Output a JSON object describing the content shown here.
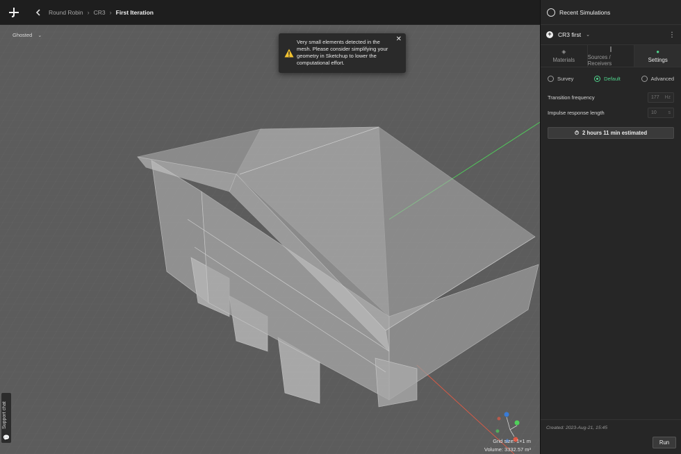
{
  "app": {
    "logo": "plus-logo-icon"
  },
  "breadcrumb": {
    "project": "Round Robin",
    "model": "CR3",
    "current": "First Iteration"
  },
  "viewport": {
    "view_mode": "Ghosted",
    "toast": {
      "message": "Very small elements detected in the mesh. Please consider simplifying your geometry in Sketchup to lower the computational effort.",
      "icon": "warning-icon"
    },
    "grid_size": "Grid size: 1×1 m",
    "volume": "Volume: 3332.57 m³",
    "axes": {
      "x_color": "#e05a45",
      "y_color": "#4fd15a",
      "z_color": "#3a7bd5"
    },
    "support_chat": "Support chat"
  },
  "panel": {
    "title": "Recent Simulations",
    "simulation_name": "CR3 first",
    "tabs": [
      {
        "label": "Materials",
        "icon": "layers-icon"
      },
      {
        "label": "Sources / Receivers",
        "icon": "waveform-icon"
      },
      {
        "label": "Settings",
        "icon": "settings-dot-icon"
      }
    ],
    "active_tab": "Settings",
    "modes": [
      "Survey",
      "Default",
      "Advanced"
    ],
    "active_mode": "Default",
    "transition_frequency": {
      "label": "Transition frequency",
      "value": "177",
      "unit": "Hz"
    },
    "impulse_response": {
      "label": "Impulse response length",
      "value": "10",
      "unit": "s"
    },
    "estimate": "2 hours 11 min estimated",
    "created": "Created: 2023-Aug-21, 15:45",
    "run_label": "Run",
    "accent": "#4fd18b"
  }
}
